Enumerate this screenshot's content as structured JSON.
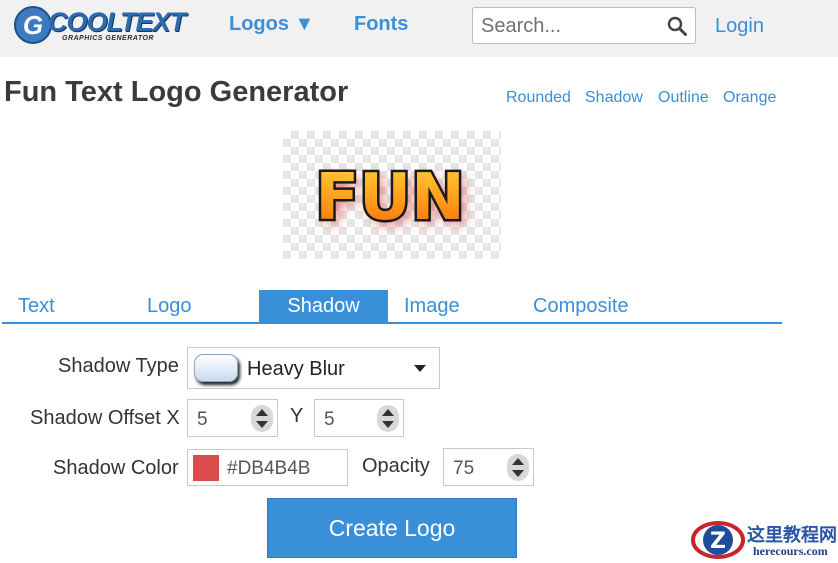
{
  "header": {
    "brand": {
      "name": "COOLTEXT",
      "tagline": "GRAPHICS GENERATOR",
      "letter": "G"
    },
    "nav": {
      "logos_label": "Logos ▼",
      "fonts_label": "Fonts"
    },
    "search": {
      "placeholder": "Search...",
      "value": ""
    },
    "login_label": "Login"
  },
  "page": {
    "title": "Fun Text Logo Generator",
    "style_links": [
      "Rounded",
      "Shadow",
      "Outline",
      "Orange"
    ]
  },
  "preview": {
    "text": "FUN"
  },
  "tabs": [
    {
      "label": "Text",
      "active": false
    },
    {
      "label": "Logo",
      "active": false
    },
    {
      "label": "Shadow",
      "active": true
    },
    {
      "label": "Image",
      "active": false
    },
    {
      "label": "Composite",
      "active": false
    }
  ],
  "form": {
    "shadow_type": {
      "label": "Shadow Type",
      "value": "Heavy Blur"
    },
    "shadow_offset": {
      "label_x": "Shadow Offset X",
      "x": "5",
      "label_y": "Y",
      "y": "5"
    },
    "shadow_color": {
      "label": "Shadow Color",
      "value": "#DB4B4B",
      "swatch": "#DB4B4B"
    },
    "opacity": {
      "label": "Opacity",
      "value": "75"
    },
    "create_label": "Create Logo"
  },
  "watermark": {
    "line1": "这里教程网",
    "line2": "herecours.com"
  },
  "colors": {
    "accent": "#3A8FD9",
    "header_bg": "#F1F1F1",
    "title": "#3B3B3B"
  }
}
